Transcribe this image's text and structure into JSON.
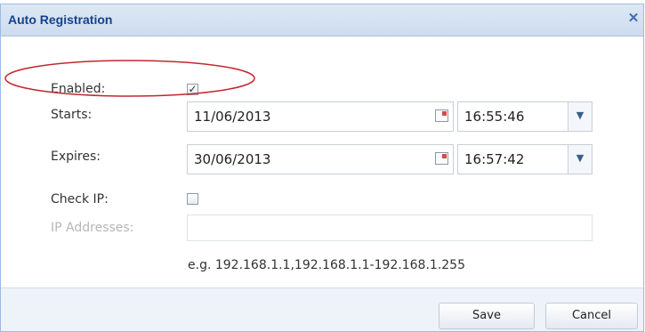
{
  "window": {
    "title": "Auto Registration",
    "close_glyph": "✕"
  },
  "form": {
    "enabled": {
      "label": "Enabled:",
      "checked": true,
      "check_glyph": "✓"
    },
    "starts": {
      "label": "Starts:",
      "date": "11/06/2013",
      "time": "16:55:46"
    },
    "expires": {
      "label": "Expires:",
      "date": "30/06/2013",
      "time": "16:57:42"
    },
    "check_ip": {
      "label": "Check IP:",
      "checked": false
    },
    "ip_addresses": {
      "label": "IP Addresses:",
      "value": "",
      "disabled": true
    },
    "hint": "e.g. 192.168.1.1,192.168.1.1-192.168.1.255",
    "dropdown_glyph": "▼"
  },
  "buttons": {
    "save": "Save",
    "cancel": "Cancel"
  },
  "colors": {
    "title_text": "#15428b",
    "annotation_ellipse": "#c0282d",
    "border": "#99bbe8"
  },
  "icons": {
    "close": "close-icon",
    "calendar": "calendar-icon",
    "dropdown": "chevron-down-icon",
    "check": "check-icon"
  }
}
